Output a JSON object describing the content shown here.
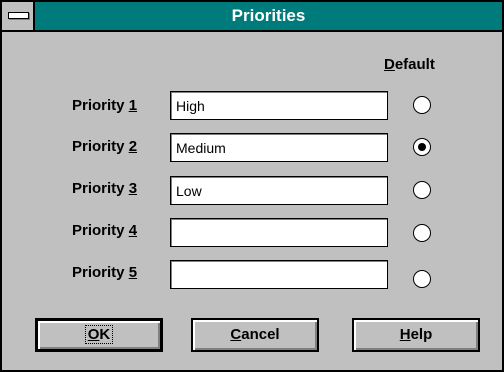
{
  "window": {
    "title": "Priorities"
  },
  "header": {
    "default_prefix": "",
    "default_mnemonic": "D",
    "default_suffix": "efault"
  },
  "rows": [
    {
      "label": "Priority ",
      "mnemonic": "1",
      "value": "High",
      "selected": false
    },
    {
      "label": "Priority ",
      "mnemonic": "2",
      "value": "Medium",
      "selected": true
    },
    {
      "label": "Priority ",
      "mnemonic": "3",
      "value": "Low",
      "selected": false
    },
    {
      "label": "Priority ",
      "mnemonic": "4",
      "value": "",
      "selected": false
    },
    {
      "label": "Priority ",
      "mnemonic": "5",
      "value": "",
      "selected": false
    }
  ],
  "buttons": {
    "ok": {
      "mnemonic": "O",
      "rest": "K"
    },
    "cancel": {
      "mnemonic": "C",
      "rest": "ancel"
    },
    "help": {
      "mnemonic": "H",
      "rest": "elp"
    }
  },
  "icons": {
    "system_menu": "system-menu-icon"
  },
  "colors": {
    "titlebar": "#007b7b",
    "face": "#c0c0c0",
    "title_text": "#ffffff"
  }
}
